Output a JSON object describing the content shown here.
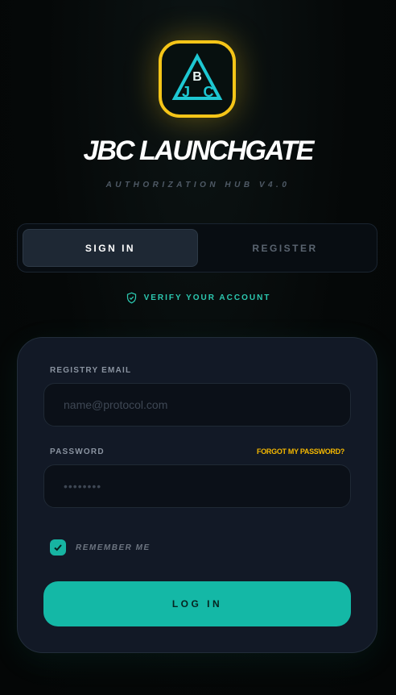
{
  "header": {
    "title": "JBC LAUNCHGATE",
    "subtitle": "AUTHORIZATION HUB V4.0",
    "logo_icon": "jbc-logo-icon"
  },
  "tabs": [
    {
      "label": "SIGN IN",
      "active": true
    },
    {
      "label": "REGISTER",
      "active": false
    }
  ],
  "verify": {
    "label": "VERIFY YOUR ACCOUNT",
    "icon": "shield-check-icon"
  },
  "form": {
    "email_label": "REGISTRY EMAIL",
    "email_placeholder": "name@protocol.com",
    "email_value": "",
    "password_label": "PASSWORD",
    "password_placeholder": "••••••••",
    "password_value": "",
    "forgot_label": "FORGOT MY PASSWORD?",
    "remember_label": "REMEMBER ME",
    "remember_checked": true,
    "submit_label": "LOG IN"
  },
  "colors": {
    "accent": "#14b8a6",
    "logo_border": "#f5c518",
    "link": "#f5b800",
    "card_bg": "#121926"
  }
}
